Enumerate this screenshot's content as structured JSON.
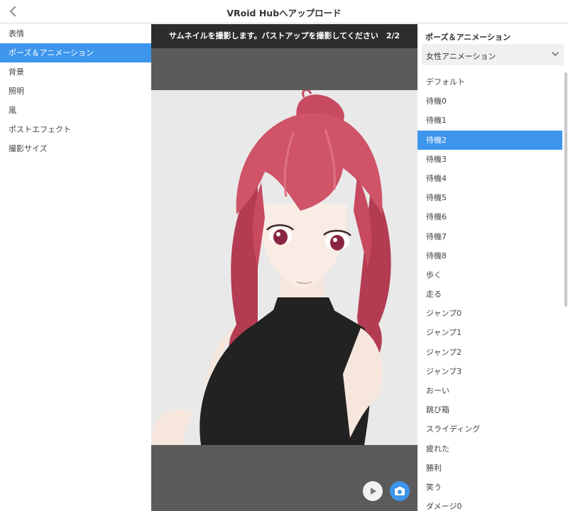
{
  "header": {
    "title": "VRoid Hubへアップロード",
    "back_icon": "chevron-left-icon"
  },
  "left_menu": {
    "items": [
      {
        "label": "表情",
        "active": false
      },
      {
        "label": "ポーズ＆アニメーション",
        "active": true
      },
      {
        "label": "背景",
        "active": false
      },
      {
        "label": "照明",
        "active": false
      },
      {
        "label": "風",
        "active": false
      },
      {
        "label": "ポストエフェクト",
        "active": false
      },
      {
        "label": "撮影サイズ",
        "active": false
      }
    ]
  },
  "center": {
    "banner": "サムネイルを撮影します。バストアップを撮影してください　2/2",
    "play_icon": "play-icon",
    "camera_icon": "camera-icon"
  },
  "right_panel": {
    "title": "ポーズ＆アニメーション",
    "dropdown_value": "女性アニメーション",
    "items": [
      "デフォルト",
      "待機0",
      "待機1",
      "待機2",
      "待機3",
      "待機4",
      "待機5",
      "待機6",
      "待機7",
      "待機8",
      "歩く",
      "走る",
      "ジャンプ0",
      "ジャンプ1",
      "ジャンプ2",
      "ジャンプ3",
      "おーい",
      "跳び箱",
      "スライディング",
      "疲れた",
      "勝利",
      "笑う",
      "ダメージ0"
    ],
    "active_index": 3
  },
  "colors": {
    "accent": "#3d95ec",
    "viewport_bg": "#5b5b5b",
    "banner_bg": "#2d2d2d",
    "hair": "#c84a60",
    "outfit": "#222222",
    "skin": "#f6e6dc"
  }
}
